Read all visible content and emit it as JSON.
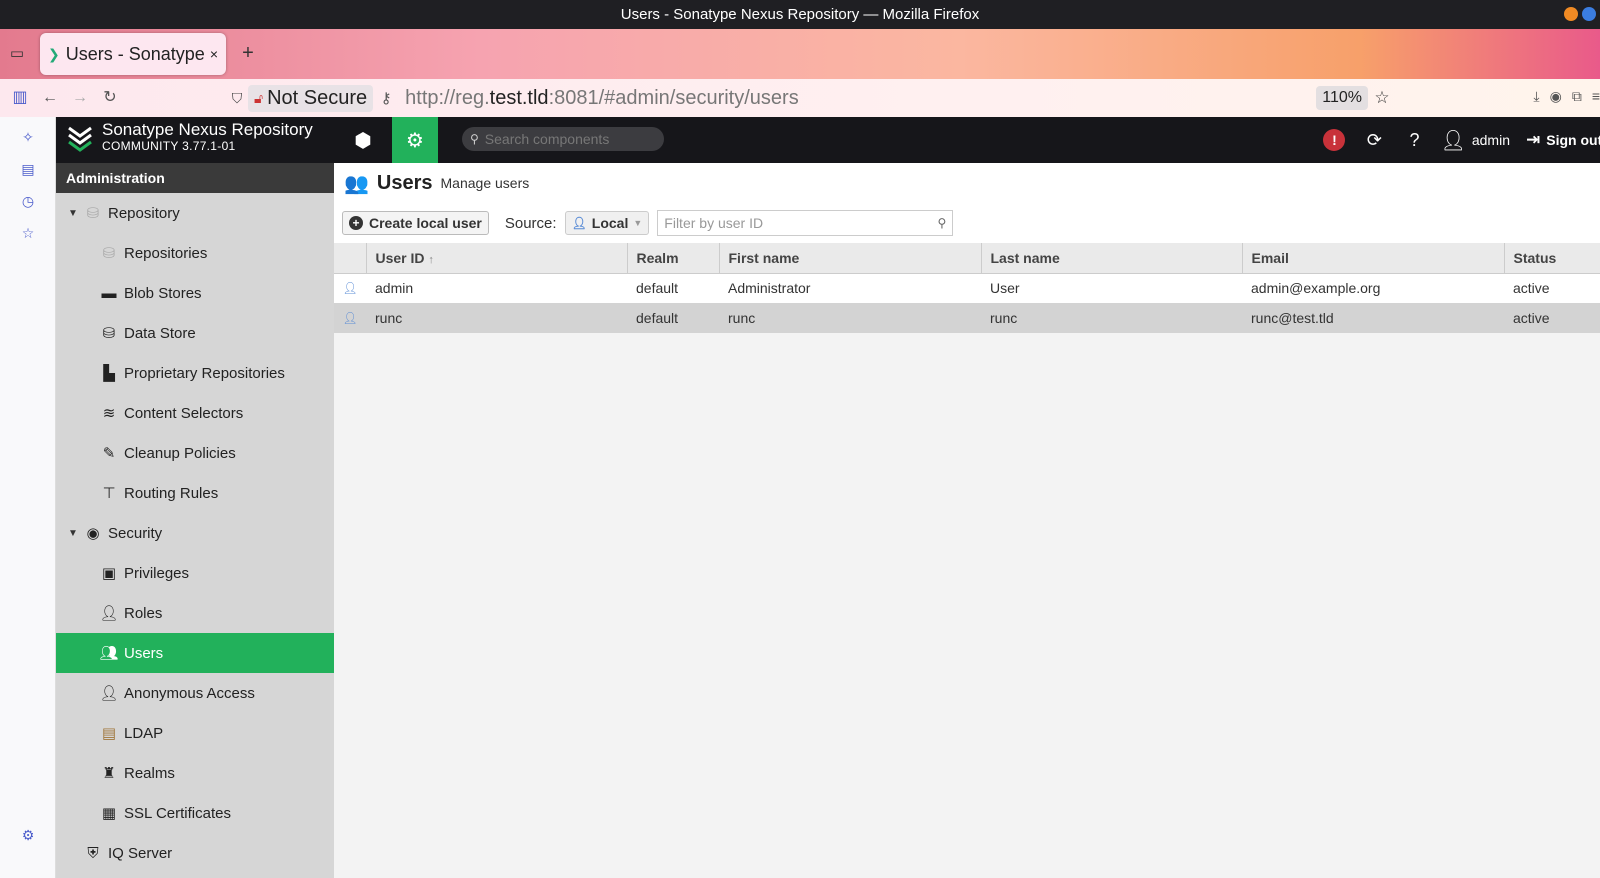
{
  "window": {
    "title": "Users - Sonatype Nexus Repository — Mozilla Firefox"
  },
  "browser": {
    "tab_title": "Users - Sonatype Nexus Repository",
    "security_label": "Not Secure",
    "url_prefix": "http://reg.",
    "url_host": "test.tld",
    "url_rest": ":8081/#admin/security/users",
    "zoom": "110%"
  },
  "nexus": {
    "brand_name": "Sonatype Nexus Repository",
    "brand_version": "COMMUNITY 3.77.1-01",
    "search_placeholder": "Search components",
    "user": "admin",
    "signout": "Sign out"
  },
  "admin_nav": {
    "title": "Administration",
    "items": [
      {
        "label": "Repository",
        "level": 0,
        "icon": "database-icon",
        "expanded": true
      },
      {
        "label": "Repositories",
        "level": 1,
        "icon": "database-icon"
      },
      {
        "label": "Blob Stores",
        "level": 1,
        "icon": "hdd-icon"
      },
      {
        "label": "Data Store",
        "level": 1,
        "icon": "database-icon"
      },
      {
        "label": "Proprietary Repositories",
        "level": 1,
        "icon": "door-icon"
      },
      {
        "label": "Content Selectors",
        "level": 1,
        "icon": "layers-icon"
      },
      {
        "label": "Cleanup Policies",
        "level": 1,
        "icon": "broom-icon"
      },
      {
        "label": "Routing Rules",
        "level": 1,
        "icon": "signpost-icon"
      },
      {
        "label": "Security",
        "level": 0,
        "icon": "eye-icon",
        "expanded": true
      },
      {
        "label": "Privileges",
        "level": 1,
        "icon": "id-badge-icon"
      },
      {
        "label": "Roles",
        "level": 1,
        "icon": "user-lock-icon"
      },
      {
        "label": "Users",
        "level": 1,
        "icon": "users-icon",
        "selected": true
      },
      {
        "label": "Anonymous Access",
        "level": 1,
        "icon": "user-icon"
      },
      {
        "label": "LDAP",
        "level": 1,
        "icon": "book-icon"
      },
      {
        "label": "Realms",
        "level": 1,
        "icon": "castle-icon"
      },
      {
        "label": "SSL Certificates",
        "level": 1,
        "icon": "id-card-icon"
      },
      {
        "label": "IQ Server",
        "level": 0,
        "icon": "shield-icon"
      }
    ]
  },
  "page": {
    "title": "Users",
    "subtitle": "Manage users",
    "create_button": "Create local user",
    "source_label": "Source:",
    "source_value": "Local",
    "filter_placeholder": "Filter by user ID"
  },
  "table": {
    "columns": [
      "User ID",
      "Realm",
      "First name",
      "Last name",
      "Email",
      "Status"
    ],
    "rows": [
      {
        "userid": "admin",
        "realm": "default",
        "first": "Administrator",
        "last": "User",
        "email": "admin@example.org",
        "status": "active"
      },
      {
        "userid": "runc",
        "realm": "default",
        "first": "runc",
        "last": "runc",
        "email": "runc@test.tld",
        "status": "active",
        "selected": true
      }
    ]
  },
  "colors": {
    "accent": "#22b15b",
    "header": "#16161a",
    "nav_bg": "#d6d6d6"
  }
}
